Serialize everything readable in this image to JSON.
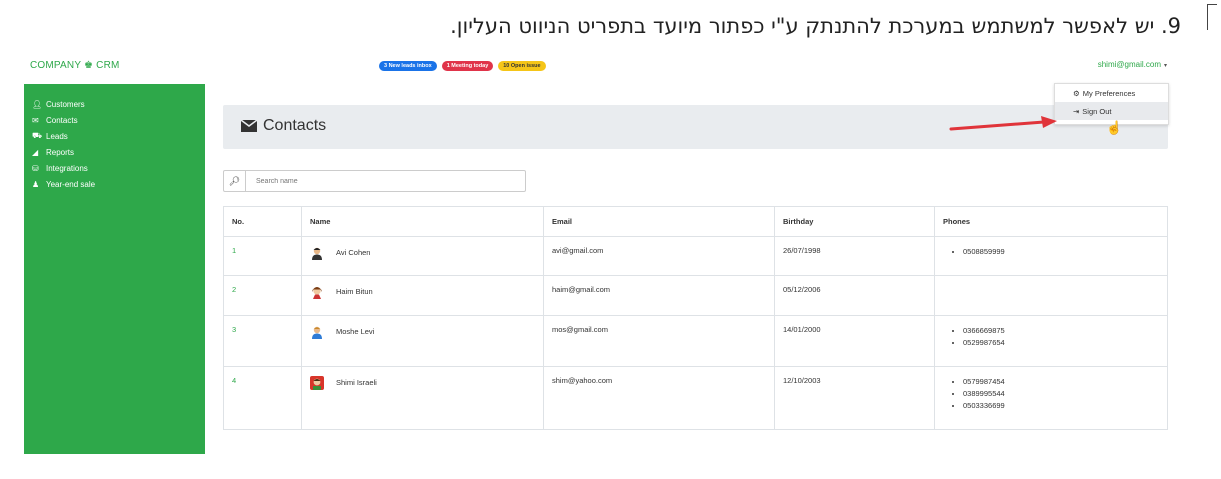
{
  "caption": {
    "text": "9. יש לאפשר למשתמש במערכת להתנתק ע\"י כפתור מיועד בתפריט הניווט העליון."
  },
  "header": {
    "brand": "COMPANY ♚ CRM",
    "badges": [
      {
        "label": "3 New leads inbox",
        "color": "#1a73e8"
      },
      {
        "label": "1 Meeting today",
        "color": "#e0344a"
      },
      {
        "label": "10 Open issue",
        "color": "#f5c518"
      }
    ],
    "user_email": "shimi@gmail.com"
  },
  "user_menu": {
    "items": [
      {
        "label": "My Preferences",
        "icon": "gear-icon"
      },
      {
        "label": "Sign Out",
        "icon": "sign-out-icon"
      }
    ]
  },
  "sidebar": {
    "items": [
      {
        "label": "Customers",
        "icon": "user-icon"
      },
      {
        "label": "Contacts",
        "icon": "envelope-icon"
      },
      {
        "label": "Leads",
        "icon": "cart-icon"
      },
      {
        "label": "Reports",
        "icon": "signal-icon"
      },
      {
        "label": "Integrations",
        "icon": "database-icon"
      },
      {
        "label": "Year-end sale",
        "icon": "bell-icon"
      }
    ]
  },
  "main": {
    "title": "Contacts",
    "search_placeholder": "Search name",
    "table": {
      "columns": [
        "No.",
        "Name",
        "Email",
        "Birthday",
        "Phones"
      ],
      "rows": [
        {
          "no": "1",
          "name": "Avi Cohen",
          "email": "avi@gmail.com",
          "birthday": "26/07/1998",
          "phones": [
            "0508859999"
          ]
        },
        {
          "no": "2",
          "name": "Haim Bitun",
          "email": "haim@gmail.com",
          "birthday": "05/12/2006",
          "phones": []
        },
        {
          "no": "3",
          "name": "Moshe Levi",
          "email": "mos@gmail.com",
          "birthday": "14/01/2000",
          "phones": [
            "0366669875",
            "0529987654"
          ]
        },
        {
          "no": "4",
          "name": "Shimi Israeli",
          "email": "shim@yahoo.com",
          "birthday": "12/10/2003",
          "phones": [
            "0579987454",
            "0389995544",
            "0503336699"
          ]
        }
      ]
    }
  },
  "colors": {
    "accent": "#2ea84a",
    "arrow": "#e0343a",
    "panel": "#e9ecef"
  }
}
